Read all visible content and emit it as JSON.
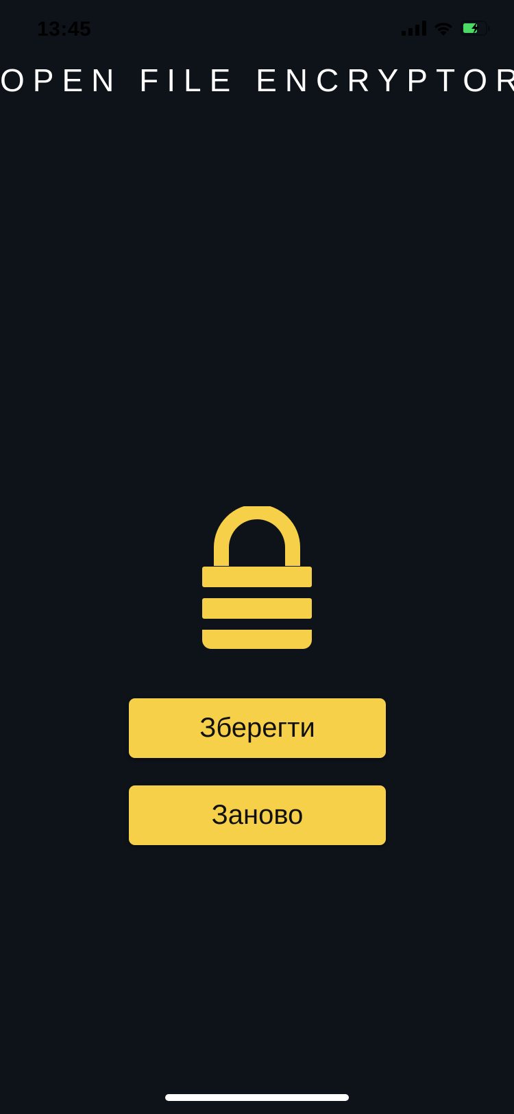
{
  "status_bar": {
    "time": "13:45",
    "icons": [
      "cellular-signal-icon",
      "wifi-icon",
      "battery-charging-icon"
    ],
    "battery_color": "#4cd964"
  },
  "app": {
    "title": "OPEN FILE ENCRYPTOR",
    "accent_color": "#f7d04a",
    "background_color": "#0e131a"
  },
  "main": {
    "icon": "lock-icon",
    "buttons": {
      "save_label": "Зберегти",
      "reset_label": "Заново"
    }
  }
}
